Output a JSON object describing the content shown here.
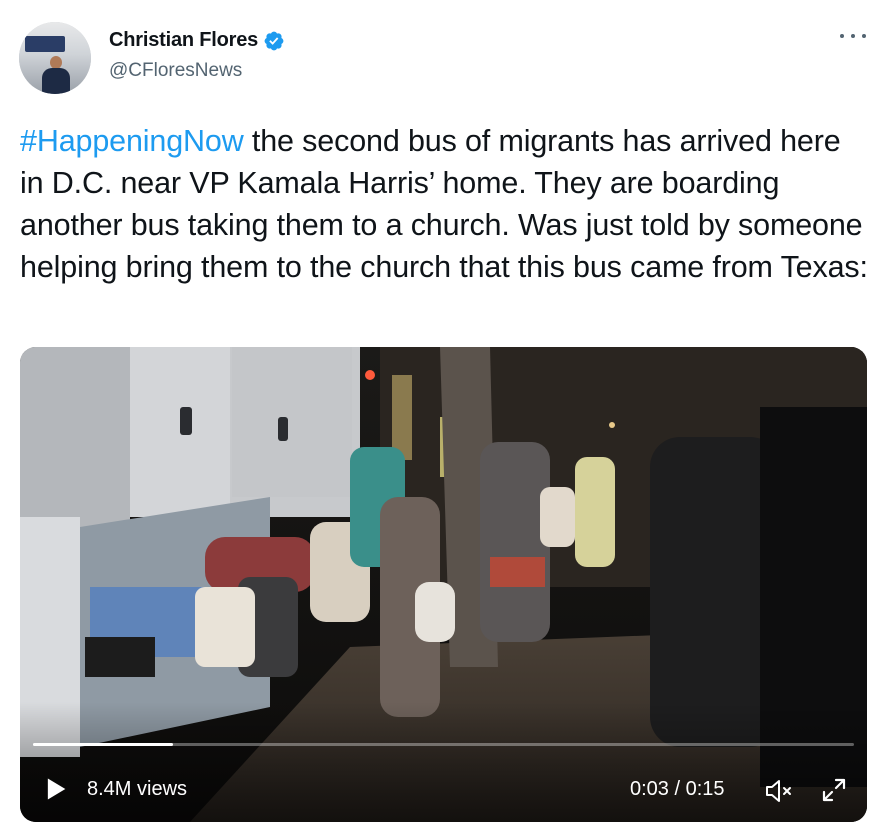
{
  "author": {
    "name": "Christian Flores",
    "handle": "@CFloresNews",
    "verified": true,
    "avatar_icon": "profile-photo"
  },
  "tweet": {
    "hashtag": "#HappeningNow",
    "text": " the second bus of migrants has arrived here in D.C. near VP Kamala Harris’ home. They are boarding another bus taking them to a church. Was just told by someone helping bring them to the church that this bus came from Texas:"
  },
  "video": {
    "views": "8.4M views",
    "time": "0:03 / 0:15",
    "progress_fraction": 0.17,
    "icons": [
      "play-icon",
      "mute-icon",
      "fullscreen-icon"
    ]
  },
  "colors": {
    "accent": "#1d9bf0",
    "text": "#0f1419",
    "secondary": "#536471"
  }
}
